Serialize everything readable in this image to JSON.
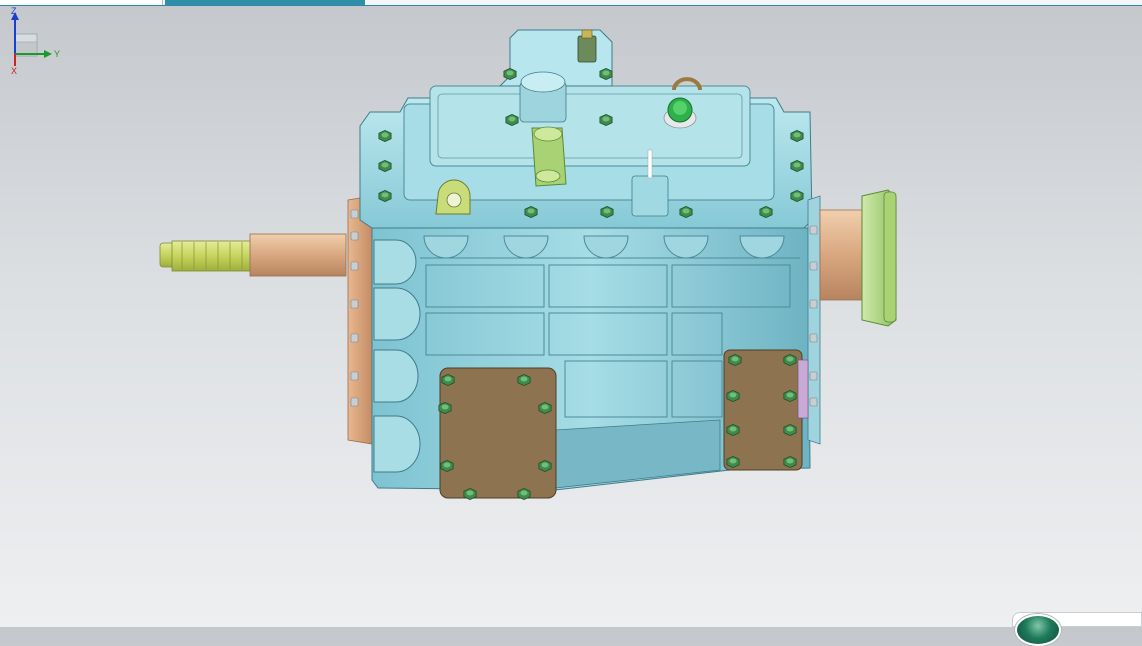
{
  "tabs": [
    {
      "label": ""
    },
    {
      "label": ""
    }
  ],
  "model": {
    "icon": "gearbox-assembly-icon",
    "colors": {
      "housing": "#8fd0dc",
      "housing_shadow": "#5fa7b6",
      "flange": "#d9a27a",
      "shaft": "#d8ae86",
      "spline": "#c9d86a",
      "bolt": "#3f8a4c",
      "bolt_highlight": "#6fbf78",
      "cover_plate": "#8d7350",
      "output_flange": "#b9df8c"
    }
  },
  "triad": {
    "z_label": "Z",
    "y_label": "Y",
    "x_label": "X",
    "z_color": "#1a3fd0",
    "y_color": "#1a9a2a",
    "x_color": "#d02020"
  }
}
